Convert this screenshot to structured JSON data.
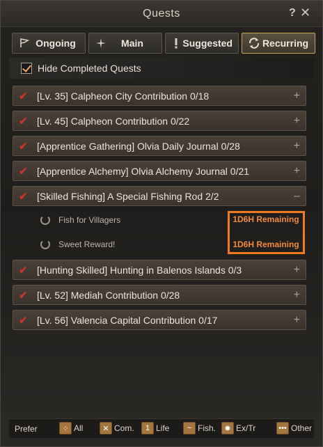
{
  "window": {
    "title": "Quests",
    "help_label": "?",
    "close_label": "✕"
  },
  "tabs": [
    {
      "label": "Ongoing",
      "icon": "flag-icon"
    },
    {
      "label": "Main",
      "icon": "star-icon"
    },
    {
      "label": "Suggested",
      "icon": "exclamation-icon"
    },
    {
      "label": "Recurring",
      "icon": "cycle-icon",
      "active": true
    }
  ],
  "hide_completed": {
    "label": "Hide Completed Quests",
    "checked": true
  },
  "quests": [
    {
      "title": "[Lv. 35] Calpheon City Contribution 0/18",
      "toggle": "+"
    },
    {
      "title": "[Lv. 45] Calpheon Contribution 0/22",
      "toggle": "+"
    },
    {
      "title": "[Apprentice Gathering] Olvia Daily Journal 0/28",
      "toggle": "+"
    },
    {
      "title": "[Apprentice Alchemy] Olvia Alchemy Journal 0/21",
      "toggle": "+"
    },
    {
      "title": "[Skilled Fishing] A Special Fishing Rod 2/2",
      "toggle": "–"
    },
    {
      "title": "[Hunting Skilled] Hunting in Balenos Islands 0/3",
      "toggle": "+"
    },
    {
      "title": "[Lv. 52] Mediah Contribution 0/28",
      "toggle": "+"
    },
    {
      "title": "[Lv. 56] Valencia Capital Contribution 0/17",
      "toggle": "+"
    }
  ],
  "subquests": [
    {
      "label": "Fish for Villagers",
      "remaining": "1D6H Remaining"
    },
    {
      "label": "Sweet Reward!",
      "remaining": "1D6H Remaining"
    }
  ],
  "footer": {
    "prefer_label": "Prefer",
    "filters": [
      {
        "label": "All",
        "icon": "all-icon"
      },
      {
        "label": "Com.",
        "icon": "combat-icon"
      },
      {
        "label": "Life",
        "icon": "life-icon"
      },
      {
        "label": "Fish.",
        "icon": "fish-icon"
      },
      {
        "label": "Ex/Tr",
        "icon": "explore-trade-icon"
      },
      {
        "label": "Other",
        "icon": "other-icon"
      }
    ]
  },
  "colors": {
    "accent": "#f07a1f",
    "check": "#c2372e",
    "remaining": "#f28a3b"
  }
}
